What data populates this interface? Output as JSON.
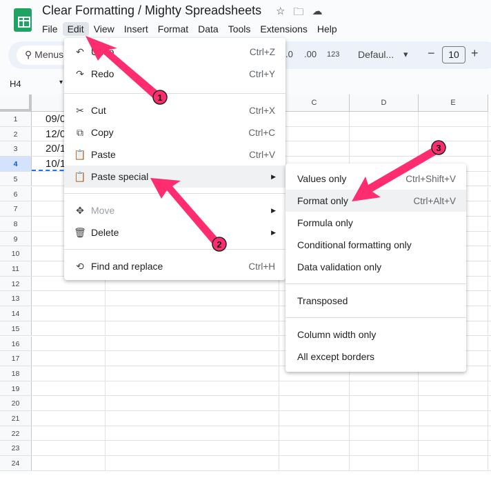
{
  "app": {
    "title": "Clear Formatting / Mighty Spreadsheets",
    "title_icons": [
      "star-icon",
      "move-folder-icon",
      "cloud-saved-icon"
    ]
  },
  "menubar": [
    "File",
    "Edit",
    "View",
    "Insert",
    "Format",
    "Data",
    "Tools",
    "Extensions",
    "Help"
  ],
  "toolbar": {
    "search_label": "Menus",
    "dec_decrease": ".0",
    "dec_increase": ".00",
    "number_format": "123",
    "font": "Defaul...",
    "font_size": "10",
    "minus": "−",
    "plus": "+"
  },
  "name_box": "H4",
  "columns": [
    "C",
    "D",
    "E"
  ],
  "rows": [
    "1",
    "2",
    "3",
    "4",
    "5",
    "6",
    "7",
    "8",
    "9",
    "10",
    "11",
    "12",
    "13",
    "14",
    "15",
    "16",
    "17",
    "18",
    "19",
    "20",
    "21",
    "22",
    "23",
    "24"
  ],
  "selected_row": "4",
  "cells_a": [
    "09/0",
    "12/0",
    "20/1",
    "10/1"
  ],
  "edit_menu": [
    {
      "icon": "undo-icon",
      "label": "Undo",
      "shortcut": "Ctrl+Z"
    },
    {
      "icon": "redo-icon",
      "label": "Redo",
      "shortcut": "Ctrl+Y"
    },
    {
      "icon": "cut-icon",
      "label": "Cut",
      "shortcut": "Ctrl+X"
    },
    {
      "icon": "copy-icon",
      "label": "Copy",
      "shortcut": "Ctrl+C"
    },
    {
      "icon": "paste-icon",
      "label": "Paste",
      "shortcut": "Ctrl+V"
    },
    {
      "icon": "paste-special-icon",
      "label": "Paste special"
    },
    {
      "icon": "move-icon",
      "label": "Move"
    },
    {
      "icon": "delete-icon",
      "label": "Delete"
    },
    {
      "icon": "find-replace-icon",
      "label": "Find and replace",
      "shortcut": "Ctrl+H"
    }
  ],
  "paste_special_menu": [
    {
      "label": "Values only",
      "shortcut": "Ctrl+Shift+V"
    },
    {
      "label": "Format only",
      "shortcut": "Ctrl+Alt+V"
    },
    {
      "label": "Formula only"
    },
    {
      "label": "Conditional formatting only"
    },
    {
      "label": "Data validation only"
    },
    {
      "label": "Transposed"
    },
    {
      "label": "Column width only"
    },
    {
      "label": "All except borders"
    }
  ],
  "annotations": {
    "step1": "1",
    "step2": "2",
    "step3": "3",
    "color": "#ff2d6f"
  }
}
